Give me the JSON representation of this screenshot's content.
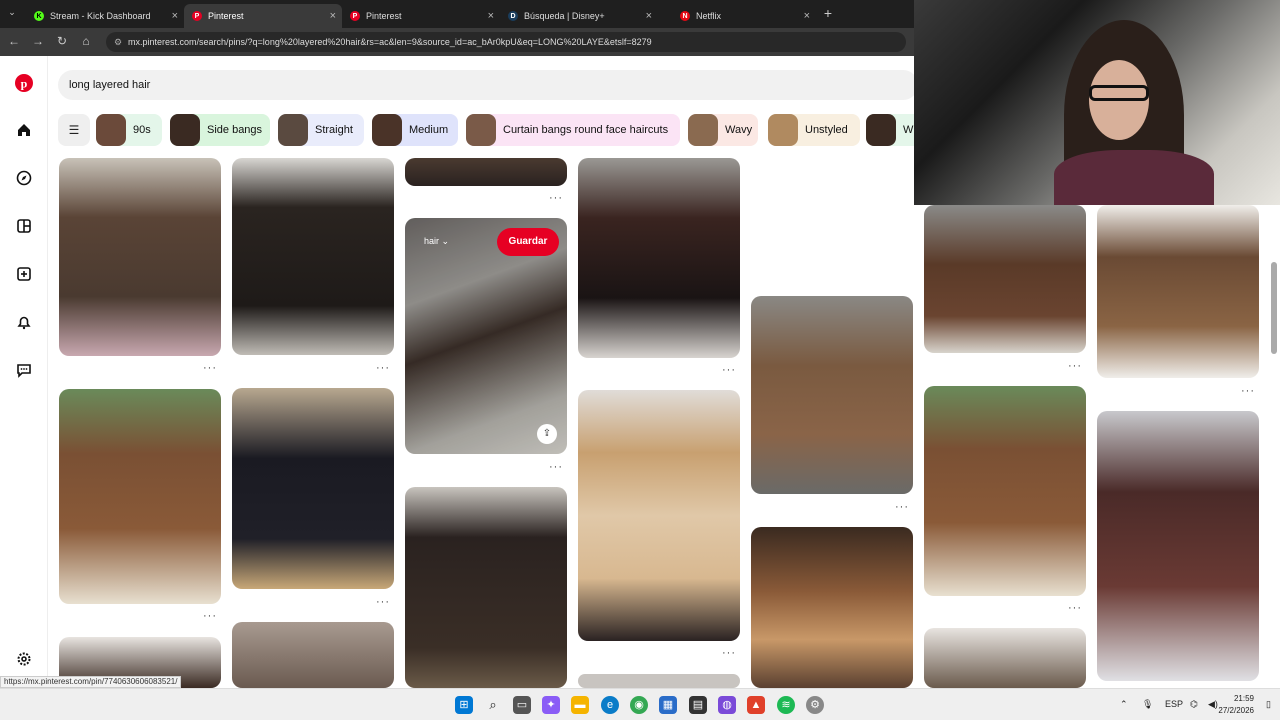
{
  "tabs": [
    {
      "title": "Stream - Kick Dashboard",
      "fav": "K",
      "color": "#53fc18",
      "active": false
    },
    {
      "title": "Pinterest",
      "fav": "P",
      "color": "#e60023",
      "active": true
    },
    {
      "title": "Pinterest",
      "fav": "P",
      "color": "#e60023",
      "active": false
    },
    {
      "title": "Búsqueda | Disney+",
      "fav": "D",
      "color": "#1a3d5c",
      "active": false
    },
    {
      "title": "Netflix",
      "fav": "N",
      "color": "#e50914",
      "active": false
    }
  ],
  "tab_close": "×",
  "new_tab": "+",
  "address": {
    "url": "mx.pinterest.com/search/pins/?q=long%20layered%20hair&rs=ac&len=9&source_id=ac_bAr0kpU&eq=LONG%20LAYE&etslf=8279"
  },
  "search": {
    "query": "long layered hair"
  },
  "chips": [
    {
      "label": "90s",
      "bg": "#e4f6ea",
      "thumb": "#6b4a3a"
    },
    {
      "label": "Side bangs",
      "bg": "#d9f5dd",
      "thumb": "#3a2a22"
    },
    {
      "label": "Straight",
      "bg": "#e9ecfb",
      "thumb": "#5a4a40"
    },
    {
      "label": "Medium",
      "bg": "#dfe3fb",
      "thumb": "#4a3328"
    },
    {
      "label": "Curtain bangs round face haircuts",
      "bg": "#fbe4f5",
      "thumb": "#7a5a48"
    },
    {
      "label": "Wavy",
      "bg": "#fbe8e4",
      "thumb": "#8a6a50"
    },
    {
      "label": "Unstyled",
      "bg": "#f8efe0",
      "thumb": "#b08a60"
    },
    {
      "label": "W",
      "bg": "#e4f6ea",
      "thumb": "#3a2a22"
    }
  ],
  "pin": {
    "save_label": "Guardar",
    "board_label": "hair ⌄",
    "more": "···",
    "share": "⇪"
  },
  "status_url": "https://mx.pinterest.com/pin/7740630606083521/",
  "tray": {
    "lang": "ESP",
    "time": "21:59",
    "date": "27/2/2026"
  },
  "icons": {
    "logo": "pinterest-logo-icon",
    "home": "home-icon",
    "explore": "compass-icon",
    "boards": "boards-icon",
    "create": "plus-icon",
    "notifications": "bell-icon",
    "messages": "chat-icon",
    "settings": "gear-icon"
  }
}
